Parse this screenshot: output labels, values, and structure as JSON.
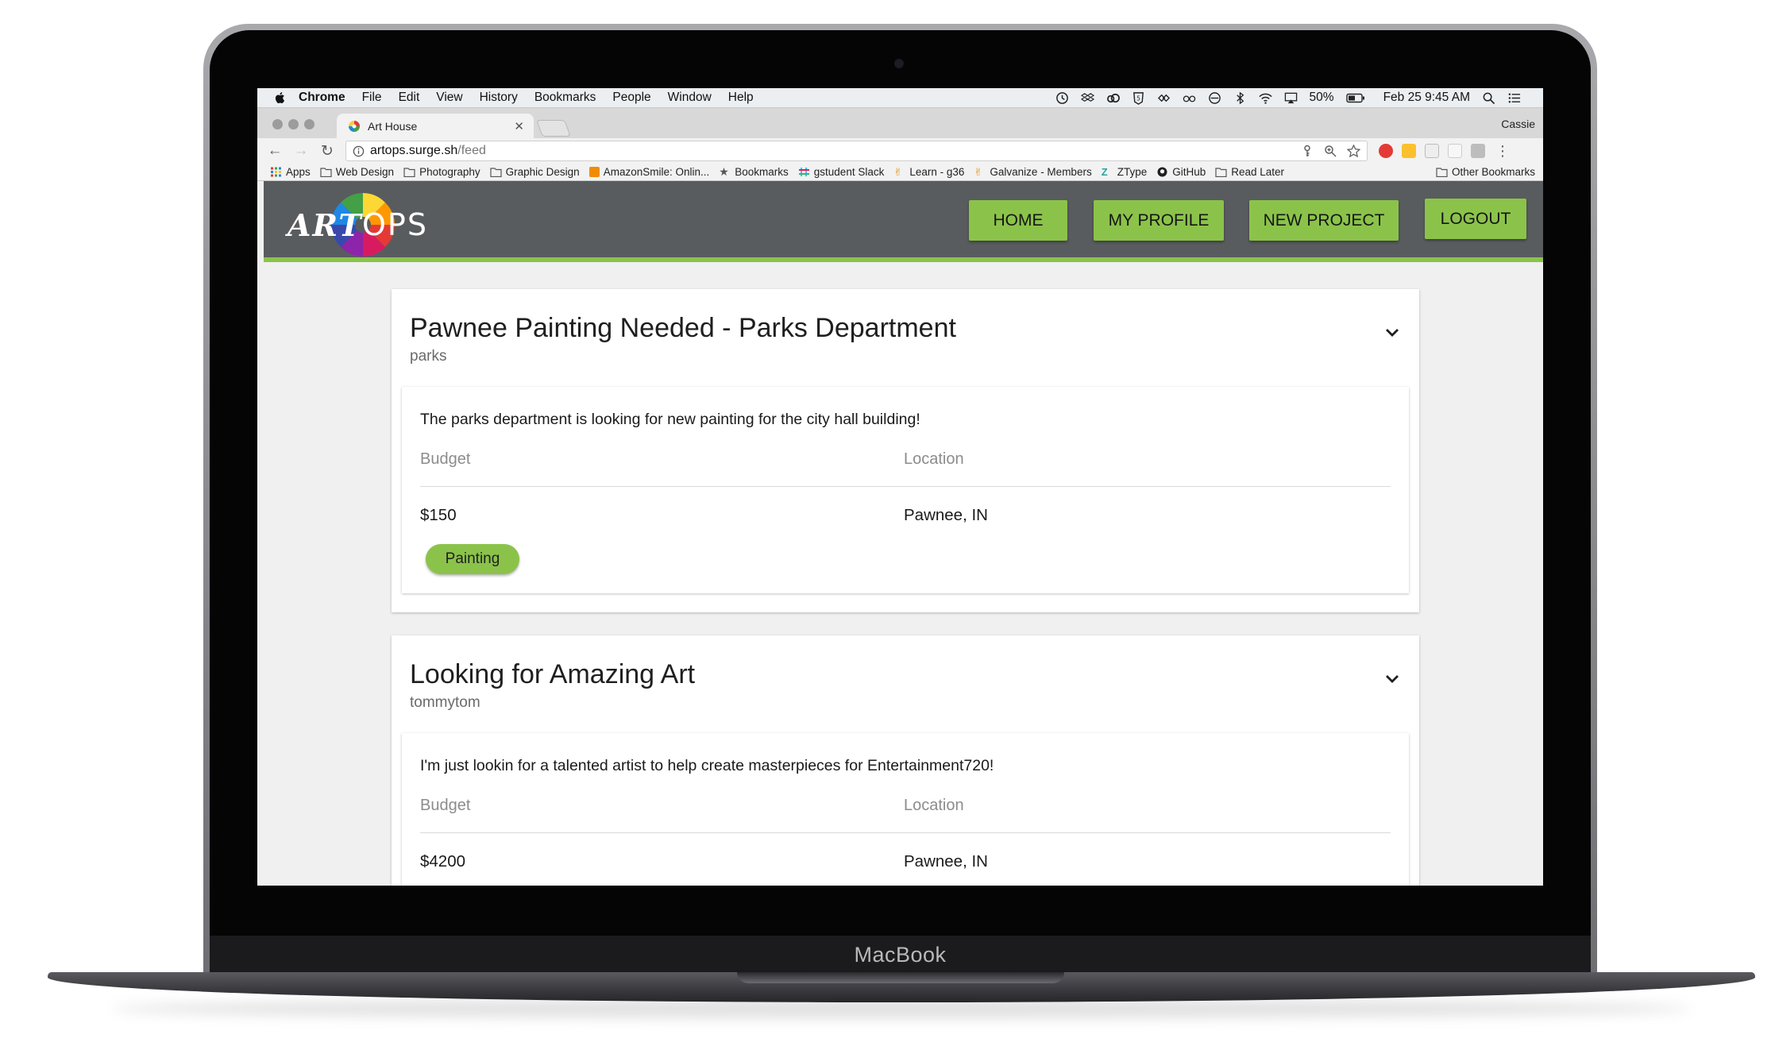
{
  "device": {
    "brand": "MacBook"
  },
  "menubar": {
    "app_name": "Chrome",
    "items": [
      "File",
      "Edit",
      "View",
      "History",
      "Bookmarks",
      "People",
      "Window",
      "Help"
    ],
    "battery": "50%",
    "datetime": "Feb 25  9:45 AM"
  },
  "browser": {
    "tab_title": "Art House",
    "profile_name": "Cassie",
    "url_host": "artops.surge.sh",
    "url_path": "/feed",
    "bookmarks": [
      {
        "label": "Apps",
        "icon": "apps-grid-icon"
      },
      {
        "label": "Web Design",
        "icon": "folder-icon"
      },
      {
        "label": "Photography",
        "icon": "folder-icon"
      },
      {
        "label": "Graphic Design",
        "icon": "folder-icon"
      },
      {
        "label": "AmazonSmile: Onlin...",
        "icon": "amazon-icon"
      },
      {
        "label": "Bookmarks",
        "icon": "star-icon"
      },
      {
        "label": "gstudent Slack",
        "icon": "slack-icon"
      },
      {
        "label": "Learn - g36",
        "icon": "galvanize-icon"
      },
      {
        "label": "Galvanize - Members",
        "icon": "galvanize-icon"
      },
      {
        "label": "ZType",
        "icon": "ztype-icon"
      },
      {
        "label": "GitHub",
        "icon": "github-icon"
      },
      {
        "label": "Read Later",
        "icon": "folder-icon"
      }
    ],
    "other_bookmarks": "Other Bookmarks"
  },
  "site": {
    "logo_art": "ART",
    "logo_ops": "OPS",
    "nav": {
      "home": "HOME",
      "my_profile": "MY PROFILE",
      "new_project": "NEW PROJECT",
      "logout": "LOGOUT"
    },
    "accent_color": "#8bc34a",
    "header_color": "#595c5e"
  },
  "projects": [
    {
      "title": "Pawnee Painting Needed - Parks Department",
      "user": "parks",
      "description": "The parks department is looking for new painting for the city hall building!",
      "budget_label": "Budget",
      "location_label": "Location",
      "budget": "$150",
      "location": "Pawnee, IN",
      "tag": "Painting"
    },
    {
      "title": "Looking for Amazing Art",
      "user": "tommytom",
      "description": "I'm just lookin for a talented artist to help create masterpieces for Entertainment720!",
      "budget_label": "Budget",
      "location_label": "Location",
      "budget": "$4200",
      "location": "Pawnee, IN"
    }
  ]
}
